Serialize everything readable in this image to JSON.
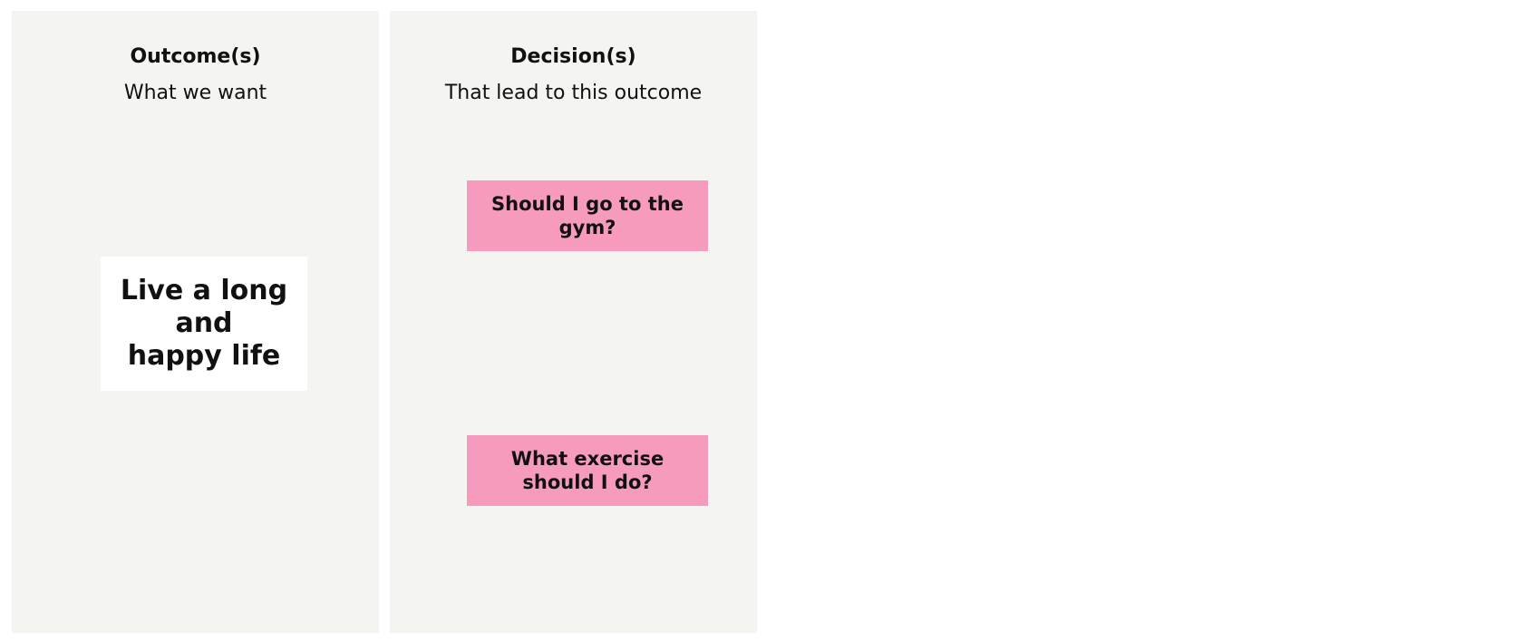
{
  "columns": [
    {
      "title": "Outcome(s)",
      "subtitle": "What we want",
      "cards": [
        {
          "text": "Live a long\nand\nhappy life",
          "color": "#ffffff"
        }
      ]
    },
    {
      "title": "Decision(s)",
      "subtitle": "That lead to this outcome",
      "cards": [
        {
          "text": "Should I go to the gym?",
          "color": "#f69bbd"
        },
        {
          "text": "What exercise should I do?",
          "color": "#f69bbd"
        }
      ]
    }
  ],
  "colors": {
    "column_background": "#f4f4f0",
    "decision_card": "#f69bbd",
    "outcome_card": "#ffffff"
  }
}
